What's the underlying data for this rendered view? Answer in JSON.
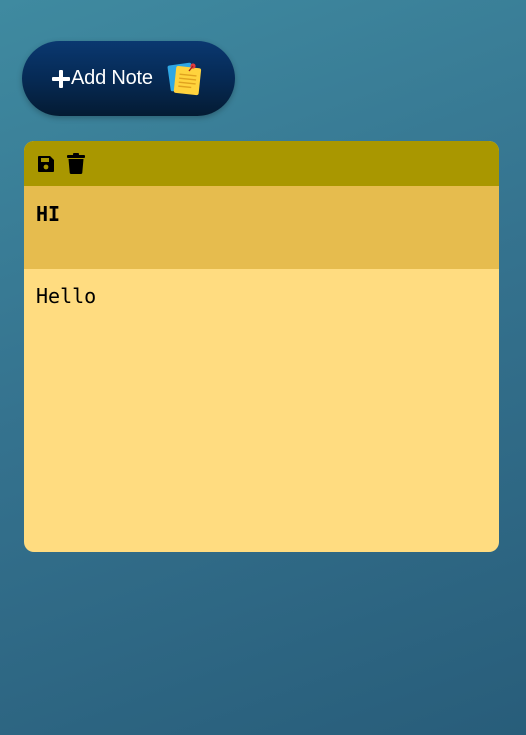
{
  "add_note": {
    "label": "Add Note",
    "plus_icon": "plus-icon",
    "notes_icon": "sticky-notes-icon",
    "colors": {
      "button_top": "#0a3870",
      "button_bottom": "#041b33",
      "text": "#ffffff"
    }
  },
  "note": {
    "toolbar": {
      "save_icon": "save-icon",
      "delete_icon": "trash-icon"
    },
    "title": "HI",
    "body": "Hello",
    "colors": {
      "toolbar": "#a99700",
      "title_bg": "#e6bc4e",
      "body_bg": "#ffdc80"
    }
  }
}
